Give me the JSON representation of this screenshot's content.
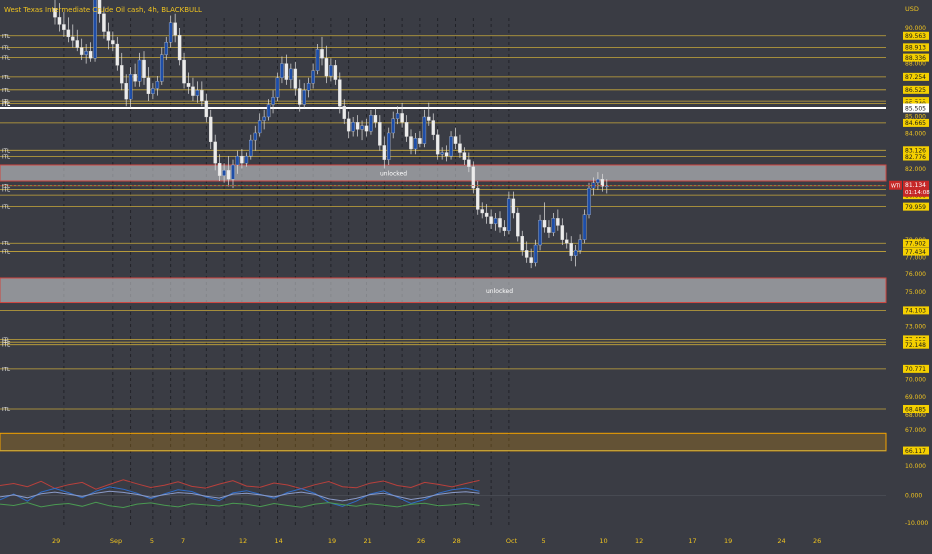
{
  "header": {
    "title": "West Texas Intermediate Crude Oil cash, 4h, BLACKBULL",
    "currency": "USD"
  },
  "colors": {
    "background": "#3a3c44",
    "level_line": "#c8a83a",
    "axis_text": "#f0c420",
    "price_tag_bg": "#f5d000",
    "last_price_bg": "#c62828",
    "zone_red_border": "#d0453f",
    "zone_fill": "#d7d9dd",
    "zone_orange_border": "#f5a300",
    "candle_up": "#1e4ea8",
    "candle_down": "#ececec"
  },
  "chart_data": {
    "type": "candlestick",
    "symbol": "WTI",
    "interval": "4h",
    "y_axis": {
      "ylim": [
        -11.3,
        92.9
      ],
      "ticks": [
        "90.000",
        "88.000",
        "85.000",
        "84.000",
        "82.000",
        "78.000",
        "77.000",
        "76.000",
        "75.000",
        "73.000",
        "70.000",
        "69.000",
        "68.000",
        "67.000",
        "10.000",
        "0.000",
        "-10.000"
      ]
    },
    "x_axis": {
      "ticks": [
        {
          "label": "29",
          "i": 0
        },
        {
          "label": "Sep",
          "i": 13
        },
        {
          "label": "5",
          "i": 22
        },
        {
          "label": "7",
          "i": 29
        },
        {
          "label": "12",
          "i": 42
        },
        {
          "label": "14",
          "i": 50
        },
        {
          "label": "19",
          "i": 62
        },
        {
          "label": "21",
          "i": 70
        },
        {
          "label": "26",
          "i": 82
        },
        {
          "label": "28",
          "i": 90
        },
        {
          "label": "Oct",
          "i": 102
        },
        {
          "label": "5",
          "i": 110
        },
        {
          "label": "10",
          "i": 123
        },
        {
          "label": "12",
          "i": 131
        },
        {
          "label": "17",
          "i": 143
        },
        {
          "label": "19",
          "i": 151
        },
        {
          "label": "24",
          "i": 163
        },
        {
          "label": "26",
          "i": 171
        }
      ],
      "day_gridlines": [
        2,
        13,
        17,
        22,
        26,
        29,
        34,
        38,
        42,
        46,
        50,
        54,
        58,
        62,
        66,
        70,
        74,
        78,
        82,
        86,
        90,
        94,
        98,
        102
      ]
    },
    "horizontal_levels": [
      {
        "label": "ITL",
        "price": 89.563,
        "tag": "89.563"
      },
      {
        "label": "ITL",
        "price": 88.913,
        "tag": "88.913"
      },
      {
        "label": "ITL",
        "price": 88.336,
        "tag": "88.336"
      },
      {
        "label": "ITL",
        "price": 87.254,
        "tag": "87.254"
      },
      {
        "label": "ITL",
        "price": 86.525,
        "tag": "86.525"
      },
      {
        "label": "ITL",
        "price": 85.889,
        "tag": "85.889"
      },
      {
        "label": "ITL",
        "price": 85.749,
        "tag": "85.749"
      },
      {
        "label": "",
        "price": 84.665,
        "tag": "84.665"
      },
      {
        "label": "ITL",
        "price": 83.126,
        "tag": "83.126"
      },
      {
        "label": "ITL",
        "price": 82.776,
        "tag": "82.776"
      },
      {
        "label": "ITL",
        "price": 81.131,
        "tag": "81.131"
      },
      {
        "label": "ITL",
        "price": 80.921,
        "tag": "80.921"
      },
      {
        "label": "",
        "price": 80.606,
        "tag": "80.606"
      },
      {
        "label": "ITL",
        "price": 79.959,
        "tag": "79.959"
      },
      {
        "label": "ITL",
        "price": 77.902,
        "tag": "77.902"
      },
      {
        "label": "ITL",
        "price": 77.434,
        "tag": "77.434"
      },
      {
        "label": "",
        "price": 74.103,
        "tag": "74.103"
      },
      {
        "label": "ITL",
        "price": 72.45,
        "tag": "72.450"
      },
      {
        "label": "ITL",
        "price": 72.292,
        "tag": "72.292"
      },
      {
        "label": "ITL",
        "price": 72.148,
        "tag": "72.148"
      },
      {
        "label": "ITL",
        "price": 70.771,
        "tag": "70.771"
      },
      {
        "label": "ITL",
        "price": 68.485,
        "tag": "68.485"
      },
      {
        "label": "",
        "price": 66.117,
        "tag": "66.117"
      }
    ],
    "white_level": {
      "label": "ITL",
      "price": 85.505,
      "tag": "85.505"
    },
    "zones": [
      {
        "type": "red",
        "top": 92.9,
        "bottom": 92.2,
        "text": ""
      },
      {
        "type": "red",
        "top": 82.3,
        "bottom": 81.4,
        "text": "unlocked"
      },
      {
        "type": "red",
        "top": 75.95,
        "bottom": 74.55,
        "text": "unlocked"
      },
      {
        "type": "orange",
        "top": 67.1,
        "bottom": 66.1,
        "text": ""
      }
    ],
    "last_price": {
      "symbol": "WTI",
      "price": "81.134",
      "countdown": "01:14:08",
      "value": 81.134
    },
    "candles": [
      {
        "o": 91.1,
        "h": 91.8,
        "l": 90.2,
        "c": 90.6
      },
      {
        "o": 90.6,
        "h": 91.4,
        "l": 89.8,
        "c": 90.2
      },
      {
        "o": 90.2,
        "h": 90.9,
        "l": 89.5,
        "c": 89.9
      },
      {
        "o": 89.9,
        "h": 90.6,
        "l": 89.2,
        "c": 89.5
      },
      {
        "o": 89.5,
        "h": 90.2,
        "l": 88.9,
        "c": 89.3
      },
      {
        "o": 89.3,
        "h": 89.9,
        "l": 88.7,
        "c": 88.9
      },
      {
        "o": 88.9,
        "h": 89.4,
        "l": 88.2,
        "c": 88.5
      },
      {
        "o": 88.5,
        "h": 89.1,
        "l": 88.0,
        "c": 88.7
      },
      {
        "o": 88.7,
        "h": 89.2,
        "l": 88.1,
        "c": 88.3
      },
      {
        "o": 88.3,
        "h": 92.8,
        "l": 88.1,
        "c": 92.4
      },
      {
        "o": 92.4,
        "h": 92.9,
        "l": 90.3,
        "c": 90.8
      },
      {
        "o": 90.8,
        "h": 91.2,
        "l": 89.4,
        "c": 89.8
      },
      {
        "o": 89.8,
        "h": 90.3,
        "l": 88.8,
        "c": 89.3
      },
      {
        "o": 89.3,
        "h": 89.8,
        "l": 88.7,
        "c": 89.1
      },
      {
        "o": 89.1,
        "h": 89.5,
        "l": 87.6,
        "c": 87.9
      },
      {
        "o": 87.9,
        "h": 88.6,
        "l": 86.5,
        "c": 86.9
      },
      {
        "o": 86.9,
        "h": 87.4,
        "l": 85.6,
        "c": 86.0
      },
      {
        "o": 86.0,
        "h": 87.8,
        "l": 85.5,
        "c": 87.4
      },
      {
        "o": 87.4,
        "h": 88.0,
        "l": 86.7,
        "c": 87.0
      },
      {
        "o": 87.0,
        "h": 88.6,
        "l": 86.7,
        "c": 88.2
      },
      {
        "o": 88.2,
        "h": 88.7,
        "l": 86.8,
        "c": 87.2
      },
      {
        "o": 87.2,
        "h": 87.8,
        "l": 85.9,
        "c": 86.3
      },
      {
        "o": 86.3,
        "h": 86.9,
        "l": 86.0,
        "c": 86.6
      },
      {
        "o": 86.6,
        "h": 87.3,
        "l": 86.2,
        "c": 87.0
      },
      {
        "o": 87.0,
        "h": 88.9,
        "l": 86.8,
        "c": 88.5
      },
      {
        "o": 88.5,
        "h": 89.5,
        "l": 88.2,
        "c": 89.2
      },
      {
        "o": 89.2,
        "h": 90.7,
        "l": 88.9,
        "c": 90.3
      },
      {
        "o": 90.3,
        "h": 90.8,
        "l": 89.2,
        "c": 89.6
      },
      {
        "o": 89.6,
        "h": 90.0,
        "l": 87.9,
        "c": 88.2
      },
      {
        "o": 88.2,
        "h": 88.6,
        "l": 86.6,
        "c": 86.9
      },
      {
        "o": 86.9,
        "h": 87.5,
        "l": 86.3,
        "c": 86.7
      },
      {
        "o": 86.7,
        "h": 87.2,
        "l": 85.9,
        "c": 86.2
      },
      {
        "o": 86.2,
        "h": 87.0,
        "l": 85.8,
        "c": 86.5
      },
      {
        "o": 86.5,
        "h": 87.0,
        "l": 85.6,
        "c": 85.9
      },
      {
        "o": 85.9,
        "h": 86.3,
        "l": 84.7,
        "c": 85.0
      },
      {
        "o": 85.0,
        "h": 85.4,
        "l": 83.2,
        "c": 83.6
      },
      {
        "o": 83.6,
        "h": 84.0,
        "l": 82.0,
        "c": 82.4
      },
      {
        "o": 82.4,
        "h": 82.9,
        "l": 81.4,
        "c": 81.7
      },
      {
        "o": 81.7,
        "h": 82.4,
        "l": 81.3,
        "c": 82.0
      },
      {
        "o": 82.0,
        "h": 82.8,
        "l": 81.1,
        "c": 81.5
      },
      {
        "o": 81.5,
        "h": 82.6,
        "l": 81.0,
        "c": 82.3
      },
      {
        "o": 82.3,
        "h": 83.1,
        "l": 81.8,
        "c": 82.8
      },
      {
        "o": 82.8,
        "h": 83.2,
        "l": 82.1,
        "c": 82.4
      },
      {
        "o": 82.4,
        "h": 83.0,
        "l": 82.2,
        "c": 82.8
      },
      {
        "o": 82.8,
        "h": 84.0,
        "l": 82.6,
        "c": 83.7
      },
      {
        "o": 83.7,
        "h": 84.5,
        "l": 83.1,
        "c": 84.1
      },
      {
        "o": 84.1,
        "h": 85.2,
        "l": 83.9,
        "c": 84.8
      },
      {
        "o": 84.8,
        "h": 85.4,
        "l": 84.3,
        "c": 85.0
      },
      {
        "o": 85.0,
        "h": 86.0,
        "l": 84.8,
        "c": 85.7
      },
      {
        "o": 85.7,
        "h": 86.5,
        "l": 85.2,
        "c": 86.1
      },
      {
        "o": 86.1,
        "h": 87.5,
        "l": 85.9,
        "c": 87.2
      },
      {
        "o": 87.2,
        "h": 88.4,
        "l": 86.9,
        "c": 88.0
      },
      {
        "o": 88.0,
        "h": 88.5,
        "l": 86.8,
        "c": 87.1
      },
      {
        "o": 87.1,
        "h": 88.0,
        "l": 86.6,
        "c": 87.7
      },
      {
        "o": 87.7,
        "h": 88.1,
        "l": 86.2,
        "c": 86.6
      },
      {
        "o": 86.6,
        "h": 87.1,
        "l": 85.3,
        "c": 85.7
      },
      {
        "o": 85.7,
        "h": 86.9,
        "l": 85.5,
        "c": 86.5
      },
      {
        "o": 86.5,
        "h": 87.2,
        "l": 86.1,
        "c": 86.9
      },
      {
        "o": 86.9,
        "h": 88.0,
        "l": 86.6,
        "c": 87.6
      },
      {
        "o": 87.6,
        "h": 89.1,
        "l": 87.4,
        "c": 88.8
      },
      {
        "o": 88.8,
        "h": 89.5,
        "l": 87.9,
        "c": 88.3
      },
      {
        "o": 88.3,
        "h": 89.0,
        "l": 86.9,
        "c": 87.3
      },
      {
        "o": 87.3,
        "h": 88.3,
        "l": 87.0,
        "c": 87.9
      },
      {
        "o": 87.9,
        "h": 88.2,
        "l": 86.8,
        "c": 87.1
      },
      {
        "o": 87.1,
        "h": 87.5,
        "l": 85.2,
        "c": 85.6
      },
      {
        "o": 85.6,
        "h": 86.0,
        "l": 84.6,
        "c": 84.9
      },
      {
        "o": 84.9,
        "h": 85.3,
        "l": 83.8,
        "c": 84.2
      },
      {
        "o": 84.2,
        "h": 85.0,
        "l": 83.9,
        "c": 84.7
      },
      {
        "o": 84.7,
        "h": 85.1,
        "l": 83.9,
        "c": 84.3
      },
      {
        "o": 84.3,
        "h": 84.8,
        "l": 83.7,
        "c": 84.5
      },
      {
        "o": 84.5,
        "h": 84.9,
        "l": 83.9,
        "c": 84.2
      },
      {
        "o": 84.2,
        "h": 85.4,
        "l": 84.0,
        "c": 85.1
      },
      {
        "o": 85.1,
        "h": 85.5,
        "l": 84.4,
        "c": 84.7
      },
      {
        "o": 84.7,
        "h": 85.1,
        "l": 83.1,
        "c": 83.4
      },
      {
        "o": 83.4,
        "h": 83.9,
        "l": 82.1,
        "c": 82.6
      },
      {
        "o": 82.6,
        "h": 84.4,
        "l": 82.3,
        "c": 84.1
      },
      {
        "o": 84.1,
        "h": 85.3,
        "l": 83.8,
        "c": 84.9
      },
      {
        "o": 84.9,
        "h": 85.6,
        "l": 84.6,
        "c": 85.2
      },
      {
        "o": 85.2,
        "h": 85.8,
        "l": 84.4,
        "c": 84.7
      },
      {
        "o": 84.7,
        "h": 85.1,
        "l": 83.6,
        "c": 83.9
      },
      {
        "o": 83.9,
        "h": 84.3,
        "l": 82.9,
        "c": 83.2
      },
      {
        "o": 83.2,
        "h": 84.1,
        "l": 82.9,
        "c": 83.8
      },
      {
        "o": 83.8,
        "h": 84.2,
        "l": 83.3,
        "c": 83.5
      },
      {
        "o": 83.5,
        "h": 85.4,
        "l": 83.3,
        "c": 85.0
      },
      {
        "o": 85.0,
        "h": 85.8,
        "l": 84.5,
        "c": 84.8
      },
      {
        "o": 84.8,
        "h": 85.2,
        "l": 83.7,
        "c": 84.0
      },
      {
        "o": 84.0,
        "h": 84.3,
        "l": 82.6,
        "c": 82.9
      },
      {
        "o": 82.9,
        "h": 83.3,
        "l": 82.6,
        "c": 83.0
      },
      {
        "o": 83.0,
        "h": 83.4,
        "l": 82.5,
        "c": 82.8
      },
      {
        "o": 82.8,
        "h": 84.2,
        "l": 82.6,
        "c": 83.9
      },
      {
        "o": 83.9,
        "h": 84.4,
        "l": 83.2,
        "c": 83.5
      },
      {
        "o": 83.5,
        "h": 84.0,
        "l": 82.7,
        "c": 83.0
      },
      {
        "o": 83.0,
        "h": 83.3,
        "l": 82.3,
        "c": 82.6
      },
      {
        "o": 82.6,
        "h": 83.0,
        "l": 81.9,
        "c": 82.2
      },
      {
        "o": 82.2,
        "h": 82.5,
        "l": 80.7,
        "c": 81.0
      },
      {
        "o": 81.0,
        "h": 81.4,
        "l": 79.5,
        "c": 79.8
      },
      {
        "o": 79.8,
        "h": 80.2,
        "l": 79.3,
        "c": 79.6
      },
      {
        "o": 79.6,
        "h": 80.1,
        "l": 79.0,
        "c": 79.4
      },
      {
        "o": 79.4,
        "h": 79.8,
        "l": 78.7,
        "c": 79.0
      },
      {
        "o": 79.0,
        "h": 79.6,
        "l": 78.6,
        "c": 79.3
      },
      {
        "o": 79.3,
        "h": 79.7,
        "l": 78.5,
        "c": 78.8
      },
      {
        "o": 78.8,
        "h": 79.2,
        "l": 78.3,
        "c": 78.6
      },
      {
        "o": 78.6,
        "h": 80.8,
        "l": 78.4,
        "c": 80.4
      },
      {
        "o": 80.4,
        "h": 80.8,
        "l": 79.3,
        "c": 79.6
      },
      {
        "o": 79.6,
        "h": 79.9,
        "l": 78.0,
        "c": 78.3
      },
      {
        "o": 78.3,
        "h": 78.6,
        "l": 77.2,
        "c": 77.5
      },
      {
        "o": 77.5,
        "h": 78.0,
        "l": 76.8,
        "c": 77.1
      },
      {
        "o": 77.1,
        "h": 77.6,
        "l": 76.5,
        "c": 76.8
      },
      {
        "o": 76.8,
        "h": 78.1,
        "l": 76.6,
        "c": 77.8
      },
      {
        "o": 77.8,
        "h": 79.5,
        "l": 77.5,
        "c": 79.2
      },
      {
        "o": 79.2,
        "h": 80.2,
        "l": 78.5,
        "c": 78.8
      },
      {
        "o": 78.8,
        "h": 79.2,
        "l": 78.2,
        "c": 78.5
      },
      {
        "o": 78.5,
        "h": 79.6,
        "l": 78.3,
        "c": 79.3
      },
      {
        "o": 79.3,
        "h": 79.8,
        "l": 78.6,
        "c": 78.9
      },
      {
        "o": 78.9,
        "h": 79.3,
        "l": 77.8,
        "c": 78.1
      },
      {
        "o": 78.1,
        "h": 78.5,
        "l": 77.6,
        "c": 77.9
      },
      {
        "o": 77.9,
        "h": 78.3,
        "l": 76.9,
        "c": 77.2
      },
      {
        "o": 77.2,
        "h": 77.8,
        "l": 76.6,
        "c": 77.5
      },
      {
        "o": 77.5,
        "h": 78.4,
        "l": 77.3,
        "c": 78.1
      },
      {
        "o": 78.1,
        "h": 79.8,
        "l": 77.9,
        "c": 79.5
      },
      {
        "o": 79.5,
        "h": 81.3,
        "l": 79.3,
        "c": 81.0
      },
      {
        "o": 81.0,
        "h": 81.6,
        "l": 80.6,
        "c": 81.3
      },
      {
        "o": 81.3,
        "h": 81.9,
        "l": 80.9,
        "c": 81.5
      },
      {
        "o": 81.5,
        "h": 81.8,
        "l": 80.8,
        "c": 81.1
      },
      {
        "o": 81.1,
        "h": 81.5,
        "l": 80.7,
        "c": 81.134
      }
    ],
    "oscillator": {
      "series": [
        {
          "color": "#b8403c",
          "values": [
            3.5,
            4.2,
            3.1,
            5.0,
            2.5,
            3.8,
            4.6,
            2.2,
            3.9,
            5.5,
            4.1,
            2.8,
            3.6,
            4.8,
            3.2,
            2.6,
            4.0,
            5.2,
            3.3,
            2.9,
            4.4,
            3.7,
            2.4,
            3.8,
            4.9,
            3.1,
            2.7,
            4.3,
            5.1,
            3.5,
            2.8,
            4.6,
            3.9,
            3.0,
            4.2,
            5.3
          ]
        },
        {
          "color": "#2f6cc8",
          "values": [
            -1.5,
            0.5,
            -2.0,
            1.2,
            2.5,
            1.0,
            -0.8,
            1.5,
            3.0,
            2.2,
            0.8,
            -1.2,
            0.6,
            2.0,
            1.4,
            -0.5,
            -1.8,
            0.9,
            1.7,
            0.4,
            -1.0,
            1.1,
            2.4,
            0.7,
            -2.5,
            -3.8,
            -2.0,
            0.5,
            1.6,
            -0.6,
            -2.8,
            -1.4,
            0.8,
            2.0,
            2.6,
            1.5
          ]
        },
        {
          "color": "#8a9ac8",
          "values": [
            -0.5,
            0.2,
            -0.8,
            0.6,
            1.2,
            0.5,
            -0.3,
            0.8,
            1.5,
            1.1,
            0.4,
            -0.6,
            0.3,
            1.0,
            0.7,
            -0.2,
            -0.9,
            0.5,
            0.8,
            0.2,
            -0.5,
            0.6,
            1.2,
            0.4,
            -1.2,
            -1.9,
            -1.0,
            0.3,
            0.8,
            -0.3,
            -1.4,
            -0.7,
            0.4,
            1.0,
            1.3,
            0.8
          ]
        },
        {
          "color": "#4a9a52",
          "values": [
            -3.0,
            -3.5,
            -2.5,
            -4.0,
            -3.2,
            -2.8,
            -3.8,
            -2.4,
            -3.6,
            -4.2,
            -3.0,
            -2.6,
            -3.4,
            -4.0,
            -2.9,
            -3.3,
            -3.7,
            -2.7,
            -3.1,
            -3.9,
            -2.8,
            -3.5,
            -4.1,
            -3.0,
            -2.5,
            -3.2,
            -3.8,
            -2.9,
            -3.4,
            -4.0,
            -3.1,
            -2.7,
            -3.6,
            -3.3,
            -2.8,
            -3.5
          ]
        }
      ]
    }
  }
}
